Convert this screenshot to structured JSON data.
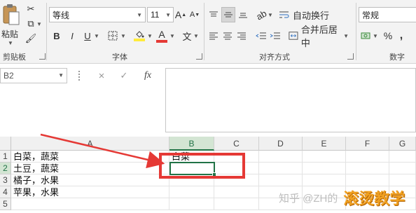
{
  "clipboard": {
    "paste_label": "粘贴",
    "group_label": "剪贴板"
  },
  "font": {
    "name": "等线",
    "size": "11",
    "group_label": "字体",
    "grow_label": "A",
    "shrink_label": "A",
    "color_label": "A",
    "bold": "B",
    "italic": "I",
    "underline": "U",
    "wen": "文"
  },
  "alignment": {
    "wrap_label": "自动换行",
    "merge_label": "合并后居中",
    "group_label": "对齐方式"
  },
  "number": {
    "format": "常规",
    "percent": "%",
    "comma": ",",
    "group_label": "数字"
  },
  "formula_bar": {
    "name_box": "B2",
    "cancel": "×",
    "enter": "✓",
    "fx": "fx",
    "content": ""
  },
  "columns": [
    "A",
    "B",
    "C",
    "D",
    "E",
    "F",
    "G"
  ],
  "rows": [
    "1",
    "2",
    "3",
    "4",
    "5"
  ],
  "cells": {
    "A1": "白菜，蔬菜",
    "A2": "土豆，蔬菜",
    "A3": "橘子，水果",
    "A4": "苹果，水果",
    "B1": "白菜"
  },
  "active_cell": "B2",
  "watermark": {
    "text": "知乎 @ZH的",
    "brand": "滚烫教学"
  },
  "colors": {
    "accent": "#217346",
    "annotation": "#e53935"
  }
}
